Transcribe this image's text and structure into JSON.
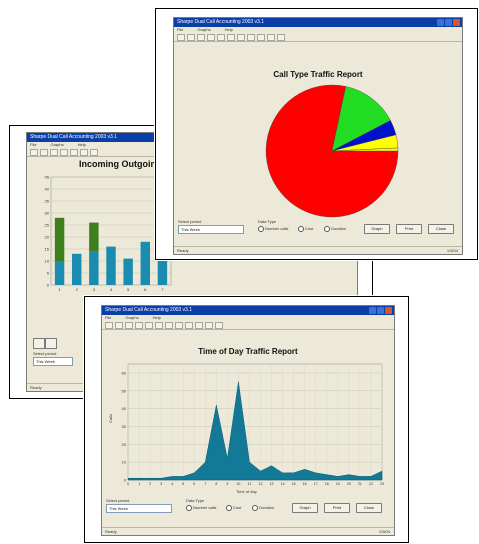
{
  "colors": {
    "titlebar": "#0a3fa8",
    "window_bg": "#ece9d8",
    "bar_teal": "#1a8cb0",
    "bar_green": "#3c7f1c",
    "pie_red": "#ff0000",
    "pie_green": "#22dd22",
    "pie_blue": "#0010cc",
    "pie_yellow": "#ffff00",
    "area_fill": "#127a96"
  },
  "windows": {
    "incoming": {
      "title": "Sharpe Dual Call Accounting 2003 v3.1",
      "menu": [
        "File",
        "Graphs",
        "Help"
      ],
      "chart_title": "Incoming Outgoing",
      "ylabel": "Calls",
      "group_label": "Select period",
      "group_value": "This Week",
      "status": "Ready"
    },
    "pie": {
      "title": "Sharpe Dual Call Accounting 2003 v3.1",
      "menu": [
        "File",
        "Graphs",
        "Help"
      ],
      "chart_title": "Call Type Traffic Report",
      "period_label": "Select period",
      "period_value": "This Week",
      "type_label": "Data Type",
      "radio_1": "Number calls",
      "radio_2": "Cost",
      "radio_3": "Duration",
      "btn_1": "Graph",
      "btn_2": "Print",
      "btn_3": "Close",
      "status": "Ready",
      "status_right": "1/3/04"
    },
    "tod": {
      "title": "Sharpe Dual Call Accounting 2003 v3.1",
      "menu": [
        "File",
        "Graphs",
        "Help"
      ],
      "chart_title": "Time of Day Traffic Report",
      "ylabel": "Calls",
      "xlabel": "Time of day",
      "period_label": "Select period",
      "period_value": "This Week",
      "type_label": "Data Type",
      "radio_1": "Number calls",
      "radio_2": "Cost",
      "radio_3": "Duration",
      "btn_1": "Graph",
      "btn_2": "Print",
      "btn_3": "Close",
      "status": "Ready",
      "status_right": "1/3/04"
    }
  },
  "chart_data": [
    {
      "type": "bar",
      "title": "Incoming Outgoing",
      "categories": [
        "1",
        "2",
        "3",
        "4",
        "5",
        "6",
        "7"
      ],
      "series": [
        {
          "values": [
            18,
            0,
            12,
            0,
            0,
            0,
            0
          ]
        },
        {
          "values": [
            10,
            13,
            14,
            16,
            11,
            18,
            11
          ]
        }
      ],
      "ylim": [
        0,
        45
      ],
      "grid": true
    },
    {
      "type": "pie",
      "title": "Call Type Traffic Report",
      "slices": [
        {
          "value": 75.6
        },
        {
          "value": 13.5
        },
        {
          "value": 3.6
        },
        {
          "value": 3.1
        },
        {
          "value": 0.7
        }
      ]
    },
    {
      "type": "area",
      "title": "Time of Day Traffic Report",
      "xlabel": "Time of day",
      "ylabel": "Calls",
      "x": [
        0,
        1,
        2,
        3,
        4,
        5,
        6,
        7,
        8,
        9,
        10,
        11,
        12,
        13,
        14,
        15,
        16,
        17,
        18,
        19,
        20,
        21,
        22,
        23
      ],
      "values": [
        1,
        1,
        1,
        1,
        2,
        2,
        4,
        10,
        42,
        12,
        55,
        10,
        5,
        8,
        4,
        4,
        6,
        4,
        3,
        2,
        3,
        2,
        2,
        5
      ],
      "ylim": [
        0,
        65
      ],
      "grid": true
    }
  ]
}
